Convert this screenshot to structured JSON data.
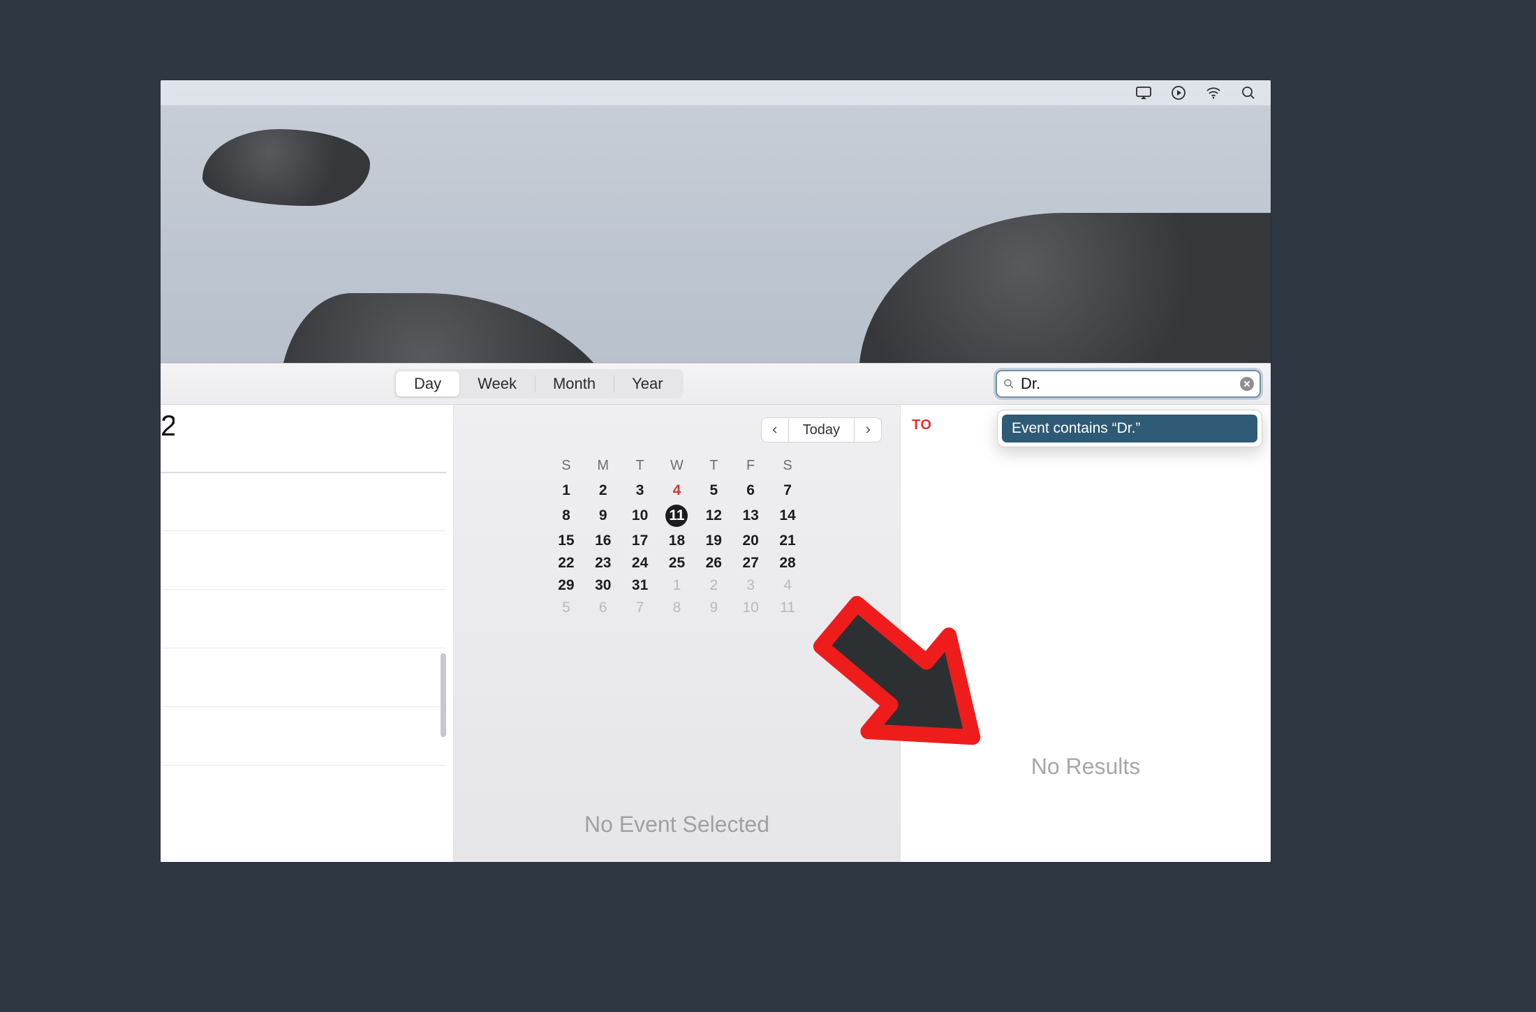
{
  "menubar": {
    "icons": [
      "screen-mirroring-icon",
      "play-circle-icon",
      "wifi-icon",
      "search-icon"
    ]
  },
  "toolbar": {
    "views": {
      "day": "Day",
      "week": "Week",
      "month": "Month",
      "year": "Year"
    },
    "active_view": "day"
  },
  "search": {
    "value": "Dr.",
    "suggestion": "Event contains “Dr.”"
  },
  "nav": {
    "today_label": "Today"
  },
  "right": {
    "today_marker": "TO",
    "no_results": "No Results"
  },
  "center": {
    "no_event": "No Event Selected"
  },
  "left": {
    "year_fragment": "2"
  },
  "mini_calendar": {
    "dow": [
      "S",
      "M",
      "T",
      "W",
      "T",
      "F",
      "S"
    ],
    "selected_day": 11,
    "holiday_day": 4,
    "rows": [
      [
        {
          "n": 1
        },
        {
          "n": 2
        },
        {
          "n": 3
        },
        {
          "n": 4,
          "holiday": true
        },
        {
          "n": 5
        },
        {
          "n": 6
        },
        {
          "n": 7
        }
      ],
      [
        {
          "n": 8
        },
        {
          "n": 9
        },
        {
          "n": 10
        },
        {
          "n": 11,
          "selected": true
        },
        {
          "n": 12
        },
        {
          "n": 13
        },
        {
          "n": 14
        }
      ],
      [
        {
          "n": 15
        },
        {
          "n": 16
        },
        {
          "n": 17
        },
        {
          "n": 18
        },
        {
          "n": 19
        },
        {
          "n": 20
        },
        {
          "n": 21
        }
      ],
      [
        {
          "n": 22
        },
        {
          "n": 23
        },
        {
          "n": 24
        },
        {
          "n": 25
        },
        {
          "n": 26
        },
        {
          "n": 27
        },
        {
          "n": 28
        }
      ],
      [
        {
          "n": 29
        },
        {
          "n": 30
        },
        {
          "n": 31
        },
        {
          "n": 1,
          "dim": true
        },
        {
          "n": 2,
          "dim": true
        },
        {
          "n": 3,
          "dim": true
        },
        {
          "n": 4,
          "dim": true
        }
      ],
      [
        {
          "n": 5,
          "dim": true
        },
        {
          "n": 6,
          "dim": true
        },
        {
          "n": 7,
          "dim": true
        },
        {
          "n": 8,
          "dim": true
        },
        {
          "n": 9,
          "dim": true
        },
        {
          "n": 10,
          "dim": true
        },
        {
          "n": 11,
          "dim": true
        }
      ]
    ]
  }
}
